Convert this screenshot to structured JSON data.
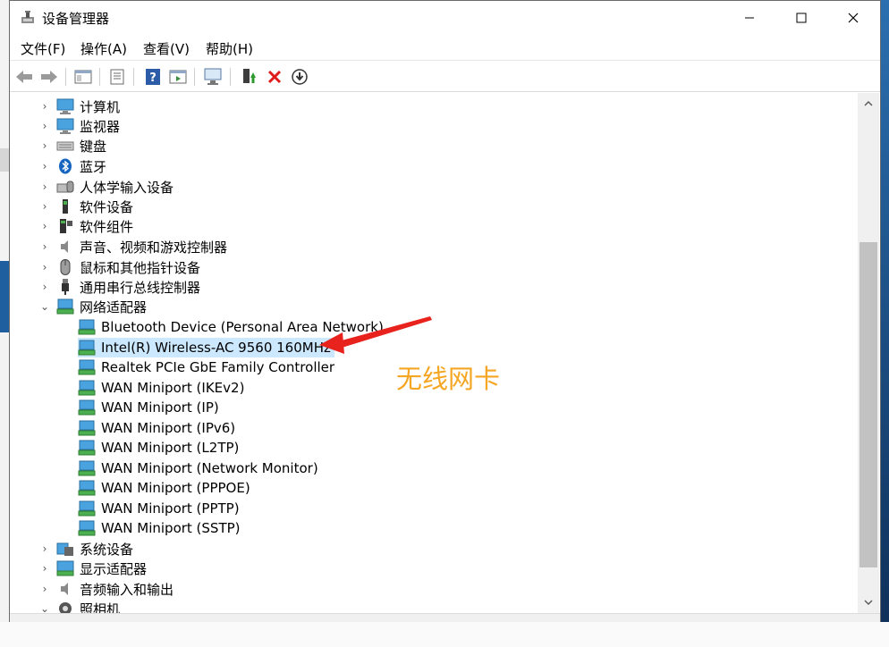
{
  "window": {
    "title": "设备管理器"
  },
  "menu": [
    {
      "label": "文件(F)"
    },
    {
      "label": "操作(A)"
    },
    {
      "label": "查看(V)"
    },
    {
      "label": "帮助(H)"
    }
  ],
  "tree": {
    "categories_top": [
      {
        "label": "计算机",
        "icon": "computer-icon"
      },
      {
        "label": "监视器",
        "icon": "monitor-icon"
      },
      {
        "label": "键盘",
        "icon": "keyboard-icon"
      },
      {
        "label": "蓝牙",
        "icon": "bluetooth-icon"
      },
      {
        "label": "人体学输入设备",
        "icon": "hid-icon"
      },
      {
        "label": "软件设备",
        "icon": "software-device-icon"
      },
      {
        "label": "软件组件",
        "icon": "software-component-icon"
      },
      {
        "label": "声音、视频和游戏控制器",
        "icon": "speaker-icon"
      },
      {
        "label": "鼠标和其他指针设备",
        "icon": "mouse-icon"
      },
      {
        "label": "通用串行总线控制器",
        "icon": "usb-icon"
      }
    ],
    "network_adapters": {
      "label": "网络适配器",
      "children": [
        {
          "label": "Bluetooth Device (Personal Area Network)"
        },
        {
          "label": "Intel(R) Wireless-AC 9560 160MHz"
        },
        {
          "label": "Realtek PCIe GbE Family Controller"
        },
        {
          "label": "WAN Miniport (IKEv2)"
        },
        {
          "label": "WAN Miniport (IP)"
        },
        {
          "label": "WAN Miniport (IPv6)"
        },
        {
          "label": "WAN Miniport (L2TP)"
        },
        {
          "label": "WAN Miniport (Network Monitor)"
        },
        {
          "label": "WAN Miniport (PPPOE)"
        },
        {
          "label": "WAN Miniport (PPTP)"
        },
        {
          "label": "WAN Miniport (SSTP)"
        }
      ]
    },
    "categories_bottom": [
      {
        "label": "系统设备",
        "icon": "system-device-icon"
      },
      {
        "label": "显示适配器",
        "icon": "display-adapter-icon"
      },
      {
        "label": "音频输入和输出",
        "icon": "audio-io-icon"
      },
      {
        "label": "照相机",
        "icon": "camera-icon"
      }
    ]
  },
  "annotation": {
    "text": "无线网卡",
    "color": "#f5a623",
    "arrow_color": "#e8231d"
  },
  "colors": {
    "selection": "#cce8ff"
  }
}
